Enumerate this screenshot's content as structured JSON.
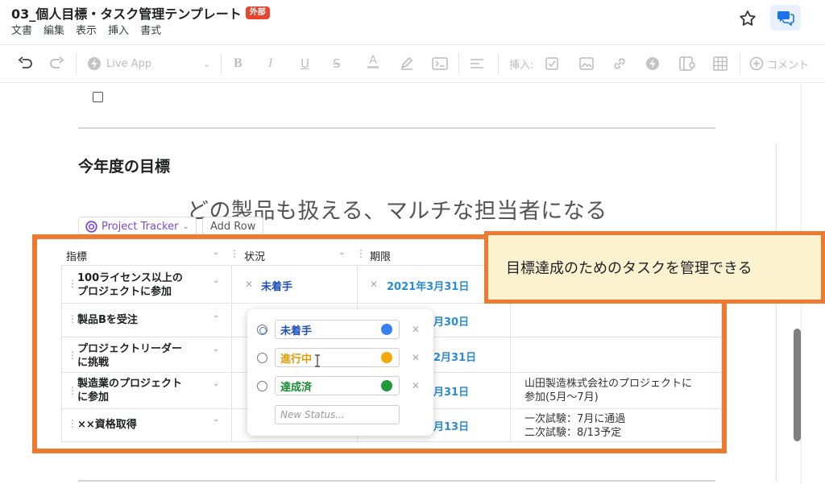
{
  "header": {
    "title": "03_個人目標・タスク管理テンプレート",
    "badge": "外部",
    "menu": [
      "文書",
      "編集",
      "表示",
      "挿入",
      "書式"
    ]
  },
  "toolbar": {
    "live_app": "Live App",
    "insert_label": "挿入:",
    "comment_label": "コメント"
  },
  "document": {
    "section_heading": "今年度の目標",
    "goal": "どの製品も扱える、マルチな担当者になる"
  },
  "table_controls": {
    "tracker_name": "Project Tracker",
    "add_row": "Add Row"
  },
  "table": {
    "columns": [
      "指標",
      "状況",
      "期限"
    ],
    "rows": [
      {
        "metric": "100ライセンス以上のプロジェクトに参加",
        "metric_l1": "100ライセンス以上の",
        "metric_l2": "プロジェクトに参加",
        "status": "未着手",
        "date": "2021年3月31日",
        "note_l1": "",
        "note_l2": ""
      },
      {
        "metric": "製品Bを受注",
        "metric_l1": "製品Bを受注",
        "metric_l2": "",
        "status": "",
        "date": "月30日",
        "note_l1": "",
        "note_l2": ""
      },
      {
        "metric": "プロジェクトリーダーに挑戦",
        "metric_l1": "プロジェクトリーダー",
        "metric_l2": "に挑戦",
        "status": "",
        "date": "2月31日",
        "note_l1": "",
        "note_l2": ""
      },
      {
        "metric": "製造業のプロジェクトに参加",
        "metric_l1": "製造業のプロジェクト",
        "metric_l2": "に参加",
        "status": "",
        "date": "月31日",
        "note_l1": "山田製造株式会社のプロジェクトに",
        "note_l2": "参加(5月～7月)"
      },
      {
        "metric": "××資格取得",
        "metric_l1": "××資格取得",
        "metric_l2": "",
        "status": "",
        "date": "月13日",
        "note_l1": "一次試験：7月に通過",
        "note_l2": "二次試験：8/13予定"
      }
    ]
  },
  "status_popup": {
    "options": [
      {
        "label": "未着手",
        "color": "#3b7ff0",
        "text_color": "#1f4fb8",
        "selected": true
      },
      {
        "label": "進行中",
        "color": "#f5a80a",
        "text_color": "#e39a00",
        "selected": false
      },
      {
        "label": "達成済",
        "color": "#1f9a3a",
        "text_color": "#1c8a35",
        "selected": false
      }
    ],
    "new_status_placeholder": "New Status..."
  },
  "callout": {
    "text": "目標達成のためのタスクを管理できる"
  },
  "colors": {
    "highlight": "#ee7a2f",
    "callout_bg": "#fdf2d0",
    "date_blue": "#2a8bd6",
    "tracker_purple": "#7a4bd8"
  }
}
